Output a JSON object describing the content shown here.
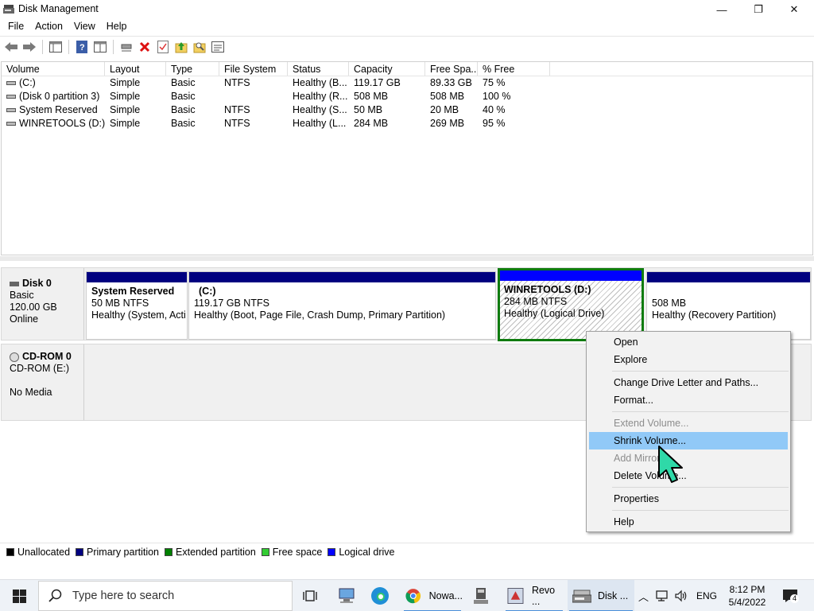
{
  "window": {
    "title": "Disk Management",
    "minimize_glyph": "—",
    "restore_glyph": "❐",
    "close_glyph": "✕"
  },
  "menu": [
    "File",
    "Action",
    "View",
    "Help"
  ],
  "toolbar": {
    "icons": [
      "back-icon",
      "forward-icon",
      "console-tree-icon",
      "help-icon",
      "properties-icon",
      "connect-icon",
      "delete-icon",
      "checklist-icon",
      "folder-up-icon",
      "search-folder-icon",
      "view-icon"
    ]
  },
  "volume_table": {
    "columns": [
      "Volume",
      "Layout",
      "Type",
      "File System",
      "Status",
      "Capacity",
      "Free Spa...",
      "% Free"
    ],
    "rows": [
      [
        "(C:)",
        "Simple",
        "Basic",
        "NTFS",
        "Healthy (B...",
        "119.17 GB",
        "89.33 GB",
        "75 %"
      ],
      [
        "(Disk 0 partition 3)",
        "Simple",
        "Basic",
        "",
        "Healthy (R...",
        "508 MB",
        "508 MB",
        "100 %"
      ],
      [
        "System Reserved",
        "Simple",
        "Basic",
        "NTFS",
        "Healthy (S...",
        "50 MB",
        "20 MB",
        "40 %"
      ],
      [
        "WINRETOOLS (D:)",
        "Simple",
        "Basic",
        "NTFS",
        "Healthy (L...",
        "284 MB",
        "269 MB",
        "95 %"
      ]
    ]
  },
  "disk0": {
    "name": "Disk 0",
    "type": "Basic",
    "size": "120.00 GB",
    "state": "Online",
    "partitions": [
      {
        "name": "System Reserved",
        "size": "50 MB NTFS",
        "status": "Healthy (System, Acti"
      },
      {
        "name": "(C:)",
        "size": "119.17 GB NTFS",
        "status": "Healthy (Boot, Page File, Crash Dump, Primary Partition)"
      },
      {
        "name": "WINRETOOLS  (D:)",
        "size": "284 MB NTFS",
        "status": "Healthy (Logical Drive)"
      },
      {
        "name": "",
        "size": "508 MB",
        "status": "Healthy (Recovery Partition)"
      }
    ]
  },
  "cdrom0": {
    "name": "CD-ROM 0",
    "drive": "CD-ROM (E:)",
    "media": "No Media"
  },
  "legend": [
    {
      "label": "Unallocated",
      "color": "#000000"
    },
    {
      "label": "Primary partition",
      "color": "#000080"
    },
    {
      "label": "Extended partition",
      "color": "#008000"
    },
    {
      "label": "Free space",
      "color": "#33cc33"
    },
    {
      "label": "Logical drive",
      "color": "#0000ff"
    }
  ],
  "context_menu": {
    "items": [
      "Open",
      "Explore",
      "Change Drive Letter and Paths...",
      "Format...",
      "Extend Volume...",
      "Shrink Volume...",
      "Add Mirror...",
      "Delete Volume...",
      "Properties",
      "Help"
    ]
  },
  "taskbar": {
    "search_placeholder": "Type here to search",
    "apps": [
      {
        "label": "Nowa..."
      },
      {
        "label": "Revo ..."
      },
      {
        "label": "Disk ..."
      }
    ],
    "language": "ENG",
    "time": "8:12 PM",
    "date": "5/4/2022",
    "notification_count": "4"
  },
  "colors": {
    "primary_bar": "#000080",
    "logical_bar": "#0000ff",
    "selection_border": "#0f7b0f",
    "menu_highlight": "#91c9f7",
    "cursor_fill": "#2fd9a8"
  }
}
